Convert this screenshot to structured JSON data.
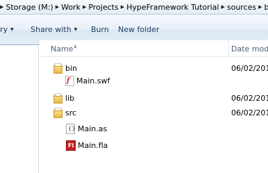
{
  "address_bar": {
    "crumbs": [
      "Storage (M:)",
      "Work",
      "Projects",
      "HypeFramework Tutorial",
      "sources",
      "ba"
    ]
  },
  "toolbar": {
    "library_label": "ry",
    "share_with_label": "Share with",
    "burn_label": "Burn",
    "new_folder_label": "New folder"
  },
  "columns": {
    "name": "Name",
    "date": "Date modif"
  },
  "files": [
    {
      "name": "bin",
      "type": "folder",
      "date": "06/02/201"
    },
    {
      "name": "Main.swf",
      "type": "swf",
      "date": ""
    },
    {
      "name": "lib",
      "type": "folder",
      "date": "06/02/201"
    },
    {
      "name": "src",
      "type": "folder",
      "date": "06/02/201"
    },
    {
      "name": "Main.as",
      "type": "as",
      "date": ""
    },
    {
      "name": "Main.fla",
      "type": "fla",
      "date": ""
    }
  ],
  "icons": {
    "folder": "folder-icon",
    "swf": "flash-swf-icon",
    "as": "actionscript-file-icon",
    "fla": "flash-fla-icon"
  },
  "colors": {
    "toolbar_text": "#1e395b",
    "fla_icon": "#c7201d",
    "swf_mark": "#cc2a1c",
    "folder": "#e8b848"
  }
}
